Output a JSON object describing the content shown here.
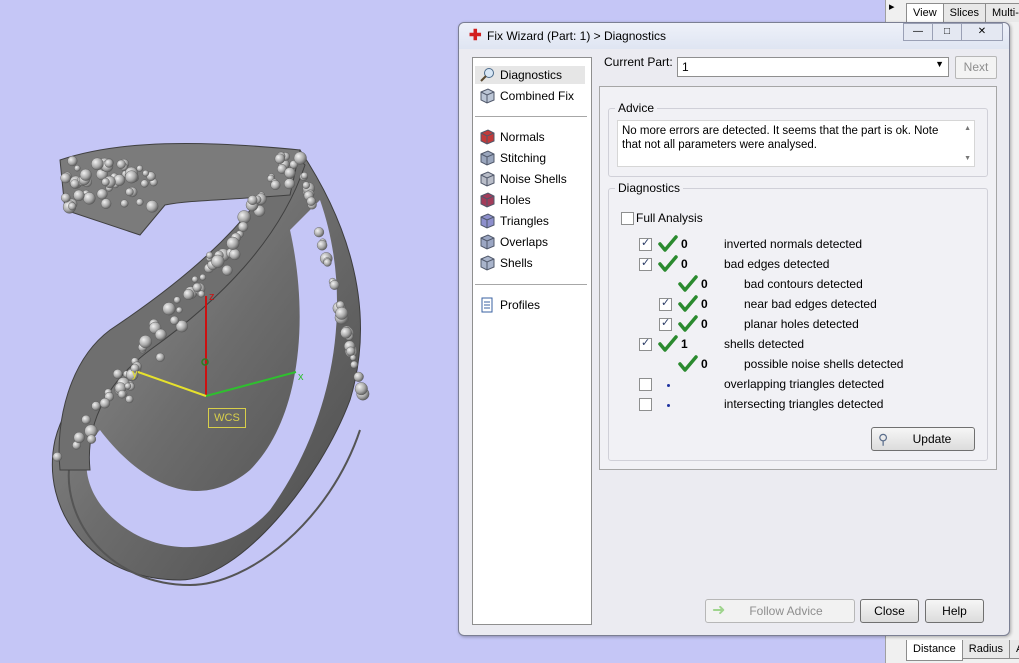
{
  "viewport": {
    "wcs_label": "WCS",
    "axis_labels": {
      "x": "x",
      "y": "y",
      "z": "z"
    },
    "axis_colors": {
      "x": "#2fbf2f",
      "y": "#e6e12c",
      "z": "#cc1111"
    }
  },
  "right_panel": {
    "top_tabs": [
      "View",
      "Slices",
      "Multi-Se"
    ],
    "bottom_tabs": [
      "Distance",
      "Radius",
      "An"
    ],
    "pin_glyph": "▸"
  },
  "dialog": {
    "title": "Fix Wizard (Part: 1) > Diagnostics",
    "window_buttons": {
      "minimize": "—",
      "maximize": "□",
      "close": "✕"
    },
    "nav": {
      "group1": [
        {
          "label": "Diagnostics",
          "icon": "magnifier-icon",
          "selected": true
        },
        {
          "label": "Combined Fix",
          "icon": "cube-icon"
        }
      ],
      "group2": [
        {
          "label": "Normals",
          "icon": "normals-cube-icon"
        },
        {
          "label": "Stitching",
          "icon": "stitching-cube-icon"
        },
        {
          "label": "Noise Shells",
          "icon": "noise-cube-icon"
        },
        {
          "label": "Holes",
          "icon": "holes-cube-icon"
        },
        {
          "label": "Triangles",
          "icon": "triangles-cube-icon"
        },
        {
          "label": "Overlaps",
          "icon": "overlaps-cube-icon"
        },
        {
          "label": "Shells",
          "icon": "shells-cube-icon"
        }
      ],
      "group3": [
        {
          "label": "Profiles",
          "icon": "document-icon"
        }
      ]
    },
    "current_part": {
      "label": "Current Part:",
      "value": "1",
      "next_label": "Next"
    },
    "advice": {
      "legend": "Advice",
      "text": "No more errors are detected. It seems that the part is ok. Note that not all parameters were analysed."
    },
    "diagnostics": {
      "legend": "Diagnostics",
      "full_analysis_label": "Full Analysis",
      "full_analysis_checked": false,
      "rows": [
        {
          "checkbox": true,
          "checked": true,
          "status": "ok",
          "count": "0",
          "label": "inverted normals detected",
          "indent": 0
        },
        {
          "checkbox": true,
          "checked": true,
          "status": "ok",
          "count": "0",
          "label": "bad edges detected",
          "indent": 0
        },
        {
          "checkbox": false,
          "checked": false,
          "status": "ok",
          "count": "0",
          "label": "bad contours detected",
          "indent": 1
        },
        {
          "checkbox": true,
          "checked": true,
          "status": "ok",
          "count": "0",
          "label": "near bad edges detected",
          "indent": 1
        },
        {
          "checkbox": true,
          "checked": true,
          "status": "ok",
          "count": "0",
          "label": "planar holes detected",
          "indent": 1
        },
        {
          "checkbox": true,
          "checked": true,
          "status": "ok",
          "count": "1",
          "label": "shells detected",
          "indent": 0
        },
        {
          "checkbox": false,
          "checked": false,
          "status": "ok",
          "count": "0",
          "label": "possible noise shells detected",
          "indent": 1
        },
        {
          "checkbox": true,
          "checked": false,
          "status": "pending",
          "count": "",
          "label": "overlapping triangles detected",
          "indent": 0
        },
        {
          "checkbox": true,
          "checked": false,
          "status": "pending",
          "count": "",
          "label": "intersecting triangles detected",
          "indent": 0
        }
      ],
      "update_label": "Update"
    },
    "footer": {
      "follow_advice": "Follow Advice",
      "close": "Close",
      "help": "Help"
    }
  },
  "colors": {
    "viewport_bg": "#c5c6f6",
    "check_green": "#2b8a2f",
    "accent_red": "#d21f1f"
  }
}
